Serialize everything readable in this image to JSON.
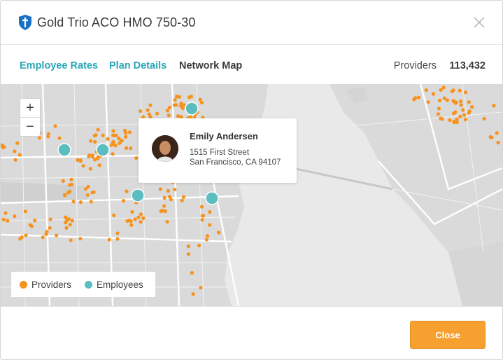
{
  "header": {
    "title": "Gold Trio ACO HMO 750-30",
    "logo_icon": "blue-shield-logo",
    "close_icon": "close-icon"
  },
  "tabs": [
    {
      "label": "Employee Rates",
      "state": "link"
    },
    {
      "label": "Plan Details",
      "state": "link"
    },
    {
      "label": "Network Map",
      "state": "active"
    }
  ],
  "providers": {
    "label": "Providers",
    "count": "113,432"
  },
  "map": {
    "zoom_in_label": "+",
    "zoom_out_label": "−",
    "popup": {
      "name": "Emily Andersen",
      "address_line1": "1515 First Street",
      "address_line2": "San Francisco, CA 94107"
    },
    "legend": [
      {
        "label": "Providers",
        "color": "#f6921e"
      },
      {
        "label": "Employees",
        "color": "#5bbdbf"
      }
    ]
  },
  "footer": {
    "close_button": "Close"
  },
  "colors": {
    "accent": "#2aa6b8",
    "provider": "#f6921e",
    "employee": "#5bbdbf",
    "button": "#f6a02f"
  }
}
